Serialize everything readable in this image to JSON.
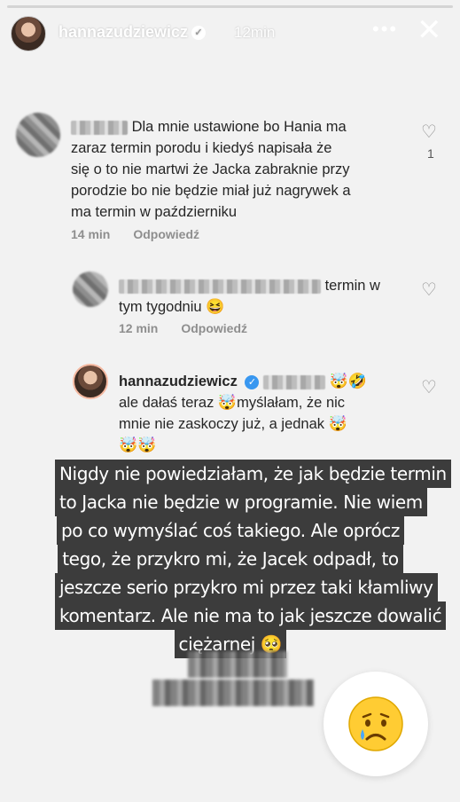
{
  "story": {
    "username": "hannazudziewicz",
    "time": "12min",
    "menu_icon": "more-horizontal-icon",
    "close_icon": "close-icon"
  },
  "comments": [
    {
      "text_line1": "Dla mnie ustawione bo Hania ma",
      "text_line2": "zaraz termin porodu i kiedyś napisała że",
      "text_line3": "się o to nie martwi że Jacka zabraknie przy",
      "text_line4": "porodzie bo nie będzie miał już nagrywek a",
      "text_line5": "ma termin w październiku",
      "time": "14 min",
      "reply": "Odpowiedź",
      "likes": "1"
    },
    {
      "text_tail": "termin w",
      "text_line2": "tym tygodniu",
      "emoji": "😆",
      "time": "12 min",
      "reply": "Odpowiedź"
    },
    {
      "username": "hannazudziewicz",
      "emoji_head": "🤯🤣",
      "text_line1a": "ale dałaś teraz",
      "emoji_mid": "🤯",
      "text_line1b": "myślałam, że nic",
      "text_line2": "mnie nie zaskoczy już, a jednak",
      "emoji_end": "🤯",
      "emoji_line3": "🤯🤯"
    }
  ],
  "overlay_text": {
    "lines": [
      "Nigdy nie powiedziałam, że jak będzie termin",
      "to Jacka nie będzie w programie. Nie wiem",
      "po co wymyślać coś takiego. Ale oprócz",
      "tego, że przykro mi, że Jacek odpadł, to",
      "jeszcze serio przykro mi przez  taki kłamliwy",
      "komentarz.  Ale nie ma to jak jeszcze dowalić",
      "ciężarnej 🥺"
    ]
  },
  "sticker": {
    "icon": "crying-face-icon"
  }
}
